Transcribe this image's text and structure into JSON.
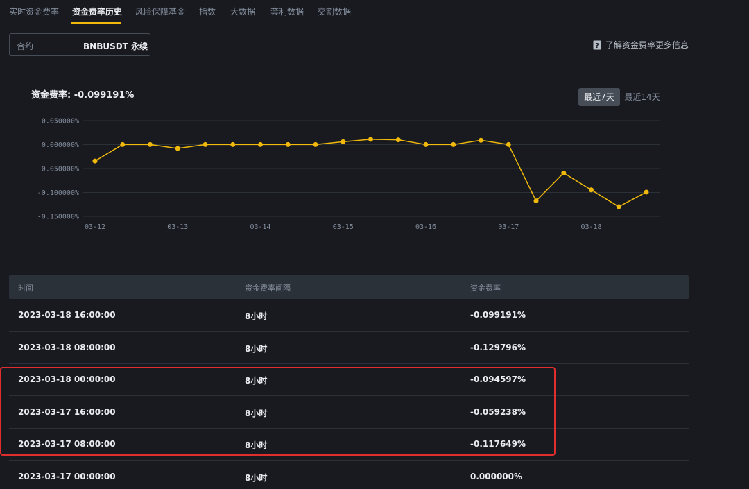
{
  "tabs": [
    {
      "label": "实时资金费率"
    },
    {
      "label": "资金费率历史"
    },
    {
      "label": "风险保障基金"
    },
    {
      "label": "指数"
    },
    {
      "label": "大数据"
    },
    {
      "label": "套利数据"
    },
    {
      "label": "交割数据"
    }
  ],
  "contract": {
    "label": "合约",
    "value": "BNBUSDT 永续"
  },
  "info_link": "了解资金费率更多信息",
  "chart_title": "资金费率: -0.099191%",
  "range_buttons": {
    "seven_days": "最近7天",
    "fourteen_days": "最近14天"
  },
  "colors": {
    "accent": "#f0b90b",
    "highlight": "#e02d2d"
  },
  "chart_data": {
    "type": "line",
    "x_tick_labels": [
      "03-12",
      "03-13",
      "03-14",
      "03-15",
      "03-16",
      "03-17",
      "03-18"
    ],
    "y_tick_labels": [
      "0.050000%",
      "0.000000%",
      "-0.050000%",
      "-0.100000%",
      "-0.150000%"
    ],
    "ylim": [
      -0.15,
      0.05
    ],
    "grid": true,
    "series": [
      {
        "values": [
          -0.0342,
          0.0001,
          0.0001,
          -0.008,
          0.0001,
          0.0001,
          0.0001,
          0.0001,
          0.0001,
          0.006,
          0.011,
          0.01,
          0.0001,
          0.0001,
          0.009,
          0.0001,
          -0.117649,
          -0.059238,
          -0.094597,
          -0.129796,
          -0.099191
        ],
        "color": "#f0b90b"
      }
    ]
  },
  "table": {
    "headers": [
      "时间",
      "资金费率间隔",
      "资金费率"
    ],
    "rows": [
      [
        "2023-03-18 16:00:00",
        "8小时",
        "-0.099191%"
      ],
      [
        "2023-03-18 08:00:00",
        "8小时",
        "-0.129796%"
      ],
      [
        "2023-03-18 00:00:00",
        "8小时",
        "-0.094597%"
      ],
      [
        "2023-03-17 16:00:00",
        "8小时",
        "-0.059238%"
      ],
      [
        "2023-03-17 08:00:00",
        "8小时",
        "-0.117649%"
      ],
      [
        "2023-03-17 00:00:00",
        "8小时",
        "0.000000%"
      ]
    ]
  }
}
